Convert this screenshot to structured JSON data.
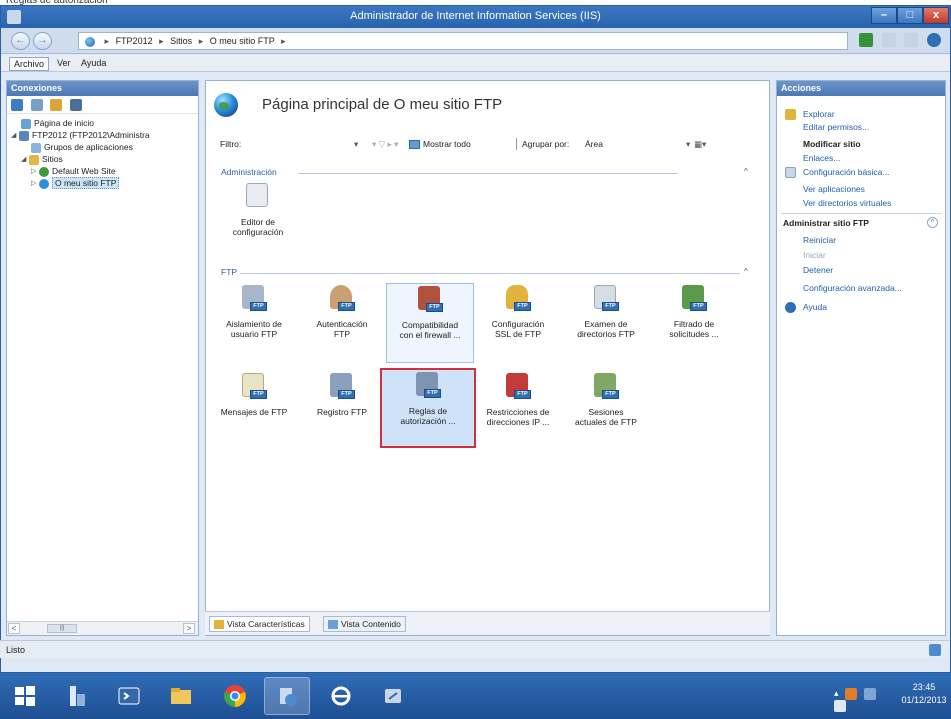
{
  "top_caption": "Reglas de autorización",
  "window": {
    "title": "Administrador de Internet Information Services (IIS)",
    "min_label": "–",
    "max_label": "□",
    "close_label": "x"
  },
  "address": {
    "back_label": "←",
    "fwd_label": "→",
    "crumbs": [
      "FTP2012",
      "Sitios",
      "O meu sitio FTP"
    ],
    "sep": "▸"
  },
  "menu": {
    "items": [
      "Archivo",
      "Ver",
      "Ayuda"
    ]
  },
  "connections": {
    "title": "Conexiones",
    "tree": [
      {
        "label": "Página de inicio",
        "indent": 1,
        "exp": ""
      },
      {
        "label": "FTP2012 (FTP2012\\Administra",
        "indent": 0,
        "exp": "◢"
      },
      {
        "label": "Grupos de aplicaciones",
        "indent": 2,
        "exp": ""
      },
      {
        "label": "Sitios",
        "indent": 1,
        "exp": "◢"
      },
      {
        "label": "Default Web Site",
        "indent": 2,
        "exp": "▷"
      },
      {
        "label": "O meu sitio FTP",
        "indent": 2,
        "exp": "▷"
      }
    ],
    "scroll_left": "<",
    "scroll_right": ">",
    "scroll_thumb": "|||"
  },
  "main": {
    "title": "Página principal de O meu sitio FTP",
    "filter_label": "Filtro:",
    "filter_dropdown": "▾",
    "filter_funnel": "▾ ▽ ▸ ▾",
    "show_all": "Mostrar todo",
    "group_by_label": "Agrupar por:",
    "group_by_value": "Área",
    "group_dropdown": "▾",
    "view_button": "▦▾",
    "groups": [
      {
        "name": "Administración",
        "caret": "^"
      },
      {
        "name": "FTP",
        "caret": "^"
      }
    ],
    "admin_features": [
      {
        "label1": "Editor de",
        "label2": "configuración"
      }
    ],
    "ftp_features": [
      {
        "label1": "Aislamiento de",
        "label2": "usuario FTP"
      },
      {
        "label1": "Autenticación",
        "label2": "FTP"
      },
      {
        "label1": "Compatibilidad",
        "label2": "con el firewall ..."
      },
      {
        "label1": "Configuración",
        "label2": "SSL de FTP"
      },
      {
        "label1": "Examen de",
        "label2": "directorios FTP"
      },
      {
        "label1": "Filtrado de",
        "label2": "solicitudes ..."
      },
      {
        "label1": "Mensajes de FTP",
        "label2": ""
      },
      {
        "label1": "Registro FTP",
        "label2": ""
      },
      {
        "label1": "Reglas de",
        "label2": "autorización ..."
      },
      {
        "label1": "Restricciones de",
        "label2": "direcciones IP ..."
      },
      {
        "label1": "Sesiones",
        "label2": "actuales de FTP"
      }
    ],
    "ftp_tag": "FTP",
    "tabs": [
      "Vista Características",
      "Vista Contenido"
    ]
  },
  "actions": {
    "title": "Acciones",
    "explore": "Explorar",
    "edit_permissions": "Editar permisos...",
    "modify_site_head": "Modificar sitio",
    "links": "Enlaces...",
    "basic_config": "Configuración básica...",
    "view_apps": "Ver aplicaciones",
    "view_vdirs": "Ver directorios virtuales",
    "manage_head": "Administrar sitio FTP",
    "manage_collapse": "^",
    "restart": "Reiniciar",
    "start": "Iniciar",
    "stop": "Detener",
    "advanced": "Configuración avanzada...",
    "help": "Ayuda"
  },
  "status": {
    "text": "Listo"
  },
  "taskbar": {
    "time": "23:45",
    "date": "01/12/2013",
    "tray_caret": "▴"
  },
  "colors": {
    "accent": "#2a63ad",
    "link": "#1d5fb0",
    "selection_border": "#d0303a"
  }
}
